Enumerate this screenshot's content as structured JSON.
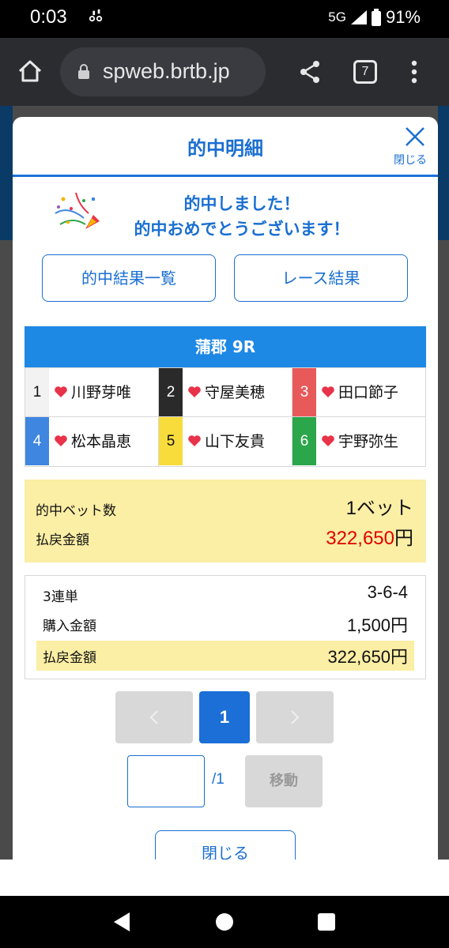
{
  "status_bar": {
    "time": "0:03",
    "network": "5G",
    "battery": "91%",
    "notification_icon": "voicemail-icon"
  },
  "browser": {
    "url": "spweb.brtb.jp",
    "tab_count": "7"
  },
  "modal": {
    "title": "的中明細",
    "close_label": "閉じる",
    "congrats_line1": "的中しました！",
    "congrats_line2": "的中おめでとうございます！",
    "btn_hit_results": "的中結果一覧",
    "btn_race_results": "レース結果",
    "race_header": "蒲郡 9R",
    "racers": [
      {
        "num": "1",
        "name": "川野芽唯",
        "bg": "#f2f2f2",
        "fg": "#111111"
      },
      {
        "num": "2",
        "name": "守屋美穂",
        "bg": "#2a2a2a",
        "fg": "#ffffff"
      },
      {
        "num": "3",
        "name": "田口節子",
        "bg": "#e85a5a",
        "fg": "#ffffff"
      },
      {
        "num": "4",
        "name": "松本晶恵",
        "bg": "#3f86e0",
        "fg": "#ffffff"
      },
      {
        "num": "5",
        "name": "山下友貴",
        "bg": "#f7dc3c",
        "fg": "#111111"
      },
      {
        "num": "6",
        "name": "宇野弥生",
        "bg": "#2ca64a",
        "fg": "#ffffff"
      }
    ],
    "summary": {
      "hit_bets_label": "的中ベット数",
      "hit_bets_value": "1ベット",
      "payout_label": "払戻金額",
      "payout_value": "322,650",
      "payout_unit": "円"
    },
    "detail": {
      "type_label": "3連単",
      "type_value": "3-6-4",
      "purchase_label": "購入金額",
      "purchase_value": "1,500円",
      "payout_label": "払戻金額",
      "payout_value": "322,650円"
    },
    "pagination": {
      "current": "1",
      "total": "/1",
      "jump_button": "移動",
      "jump_value": ""
    },
    "close_button": "閉じる"
  },
  "colors": {
    "accent": "#1a6fd1",
    "race_header": "#1e88e5",
    "highlight": "#fbeea5",
    "payout_red": "#e00000",
    "heart": "#e8334a"
  }
}
